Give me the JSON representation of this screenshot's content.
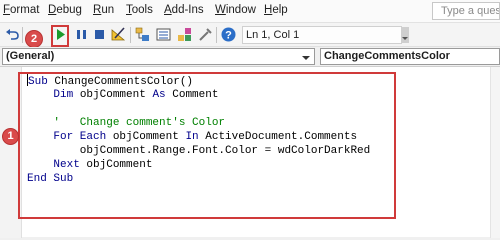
{
  "menu": {
    "items": [
      {
        "label": "Format",
        "underline_index": 0
      },
      {
        "label": "Debug",
        "underline_index": 0
      },
      {
        "label": "Run",
        "underline_index": 0
      },
      {
        "label": "Tools",
        "underline_index": 0
      },
      {
        "label": "Add-Ins",
        "underline_index": 0
      },
      {
        "label": "Window",
        "underline_index": 0
      },
      {
        "label": "Help",
        "underline_index": 0
      }
    ],
    "ask_placeholder": "Type a questi"
  },
  "toolbar": {
    "position_text": "Ln 1, Col 1",
    "icons": [
      "undo-icon",
      "redo-icon",
      "run-icon",
      "break-icon",
      "reset-icon",
      "design-mode-icon",
      "project-explorer-icon",
      "properties-window-icon",
      "object-browser-icon",
      "toolbox-icon",
      "help-icon"
    ]
  },
  "annotations": {
    "badge_run": "2",
    "badge_code": "1",
    "color": "#d03a3a"
  },
  "dropdowns": {
    "object": "(General)",
    "procedure": "ChangeCommentsColor"
  },
  "code": {
    "lines": [
      {
        "parts": [
          {
            "t": "Sub",
            "k": "kw"
          },
          {
            "t": " ChangeCommentsColor()",
            "k": ""
          }
        ]
      },
      {
        "parts": [
          {
            "t": "    ",
            "k": ""
          },
          {
            "t": "Dim",
            "k": "kw"
          },
          {
            "t": " objComment ",
            "k": ""
          },
          {
            "t": "As",
            "k": "kw"
          },
          {
            "t": " Comment",
            "k": ""
          }
        ]
      },
      {
        "parts": []
      },
      {
        "parts": [
          {
            "t": "    ",
            "k": ""
          },
          {
            "t": "'   Change comment's Color",
            "k": "cm"
          }
        ]
      },
      {
        "parts": [
          {
            "t": "    ",
            "k": ""
          },
          {
            "t": "For Each",
            "k": "kw"
          },
          {
            "t": " objComment ",
            "k": ""
          },
          {
            "t": "In",
            "k": "kw"
          },
          {
            "t": " ActiveDocument.Comments",
            "k": ""
          }
        ]
      },
      {
        "parts": [
          {
            "t": "        objComment.Range.Font.Color = wdColorDarkRed",
            "k": ""
          }
        ]
      },
      {
        "parts": [
          {
            "t": "    ",
            "k": ""
          },
          {
            "t": "Next",
            "k": "kw"
          },
          {
            "t": " objComment",
            "k": ""
          }
        ]
      },
      {
        "parts": [
          {
            "t": "End Sub",
            "k": "kw"
          }
        ]
      }
    ]
  }
}
